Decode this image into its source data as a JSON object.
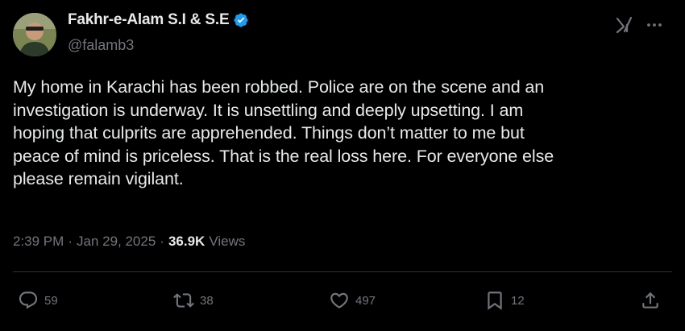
{
  "author": {
    "display_name": "Fakhr-e-Alam S.I & S.E",
    "handle": "@falamb3",
    "verified": true
  },
  "tweet": {
    "text": "My home in Karachi has been robbed. Police are on the scene and an\ninvestigation is underway. It is unsettling and deeply upsetting. I am\nhoping that culprits are apprehended. Things don’t matter to me but\npeace of mind is priceless. That is the real loss here. For everyone else\nplease remain vigilant.",
    "time": "2:39 PM",
    "separator": "·",
    "date": "Jan 29, 2025",
    "views_count": "36.9K",
    "views_label": "Views"
  },
  "actions": {
    "replies": "59",
    "reposts": "38",
    "likes": "497",
    "bookmarks": "12"
  },
  "colors": {
    "background": "#000000",
    "text": "#e7e9ea",
    "muted": "#71767b",
    "verified": "#1d9bf0"
  },
  "icons": [
    "verified-icon",
    "grok-icon",
    "more-icon",
    "reply-icon",
    "repost-icon",
    "like-icon",
    "bookmark-icon",
    "share-icon"
  ]
}
